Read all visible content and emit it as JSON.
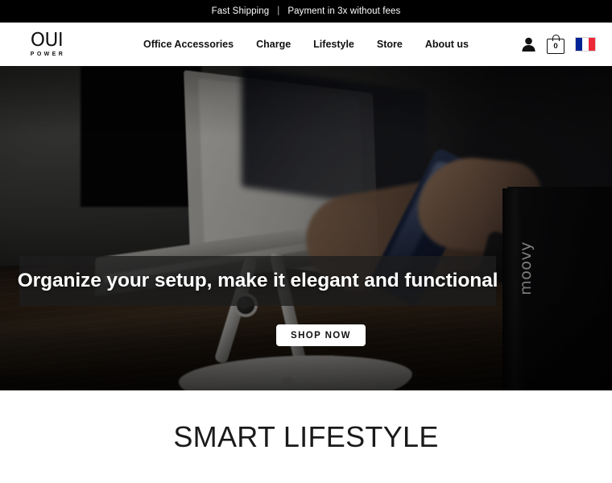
{
  "announcement": {
    "left_text": "Fast Shipping",
    "separator": "|",
    "right_text": "Payment in 3x without fees"
  },
  "header": {
    "logo": {
      "main": "OUI",
      "sub": "POWER"
    },
    "nav": [
      {
        "label": "Office Accessories"
      },
      {
        "label": "Charge"
      },
      {
        "label": "Lifestyle"
      },
      {
        "label": "Store"
      },
      {
        "label": "About us"
      }
    ],
    "account_icon": "user-icon",
    "cart": {
      "icon": "shopping-bag-icon",
      "count": "0"
    },
    "language": {
      "icon": "french-flag-icon",
      "colors": [
        "#002395",
        "#ffffff",
        "#ED2939"
      ]
    }
  },
  "hero": {
    "title": "Organize your setup, make it elegant and functional",
    "cta_label": "SHOP NOW",
    "product_label": "moovy"
  },
  "lifestyle_section": {
    "title": "SMART LIFESTYLE"
  },
  "colors": {
    "announcement_bg": "#000000",
    "header_bg": "#ffffff",
    "text": "#111111",
    "banner_overlay": "rgba(30,30,30,0.78)",
    "cta_bg": "#ffffff"
  }
}
